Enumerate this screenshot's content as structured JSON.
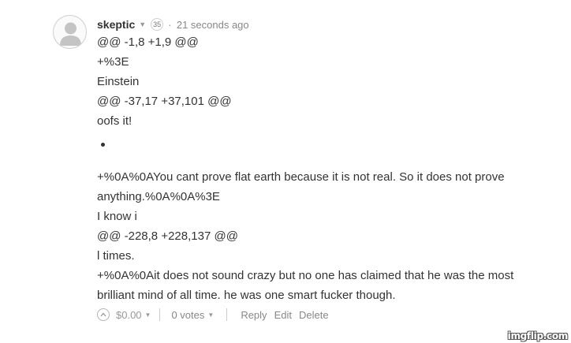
{
  "comment": {
    "author": "skeptic",
    "reputation": "35",
    "separator": "·",
    "timestamp": "21 seconds ago",
    "body_lines": [
      "@@ -1,8 +1,9 @@",
      "+%3E",
      "Einstein",
      "@@ -37,17 +37,101 @@",
      "oofs it!",
      "+%0A%0AYou cant prove flat earth because it is not real. So it does not prove",
      "anything.%0A%0A%3E",
      "I know i",
      "@@ -228,8 +228,137 @@",
      "l times.",
      "+%0A%0Ait does not sound crazy but no one has claimed that he was the most",
      "brilliant mind of all time. he was one smart fucker though."
    ]
  },
  "footer": {
    "amount": "$0.00",
    "votes": "0 votes",
    "reply_label": "Reply",
    "edit_label": "Edit",
    "delete_label": "Delete"
  },
  "watermark": "imgflip.com",
  "icons": {
    "avatar": "user-silhouette-icon",
    "caret": "caret-down-icon",
    "upvote": "chevron-up-circle-icon"
  }
}
